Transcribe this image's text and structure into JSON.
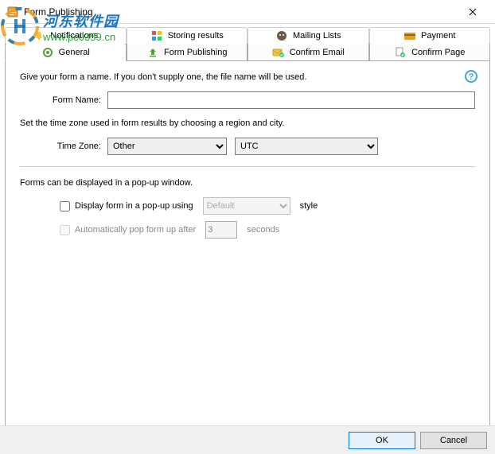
{
  "window": {
    "title": "Form Publishing"
  },
  "watermark": {
    "cn": "河东软件园",
    "url": "www.pc0359.cn"
  },
  "tabs": {
    "upper": [
      {
        "label": "Notifications"
      },
      {
        "label": "Storing results"
      },
      {
        "label": "Mailing Lists"
      },
      {
        "label": "Payment"
      }
    ],
    "lower": [
      {
        "label": "General"
      },
      {
        "label": "Form Publishing"
      },
      {
        "label": "Confirm Email"
      },
      {
        "label": "Confirm Page"
      }
    ]
  },
  "general": {
    "intro": "Give your form a name. If you don't supply one, the file name will be used.",
    "form_name_label": "Form Name:",
    "form_name_value": "",
    "timezone_intro": "Set the time zone used in form results by choosing a region and city.",
    "timezone_label": "Time Zone:",
    "timezone_region": "Other",
    "timezone_city": "UTC",
    "popup_intro": "Forms can be displayed in a pop-up window.",
    "popup_checkbox_label": "Display form in a pop-up using",
    "popup_style_value": "Default",
    "popup_style_suffix": "style",
    "autopop_label": "Automatically pop form up after",
    "autopop_seconds": "3",
    "autopop_suffix": "seconds"
  },
  "buttons": {
    "ok": "OK",
    "cancel": "Cancel"
  }
}
